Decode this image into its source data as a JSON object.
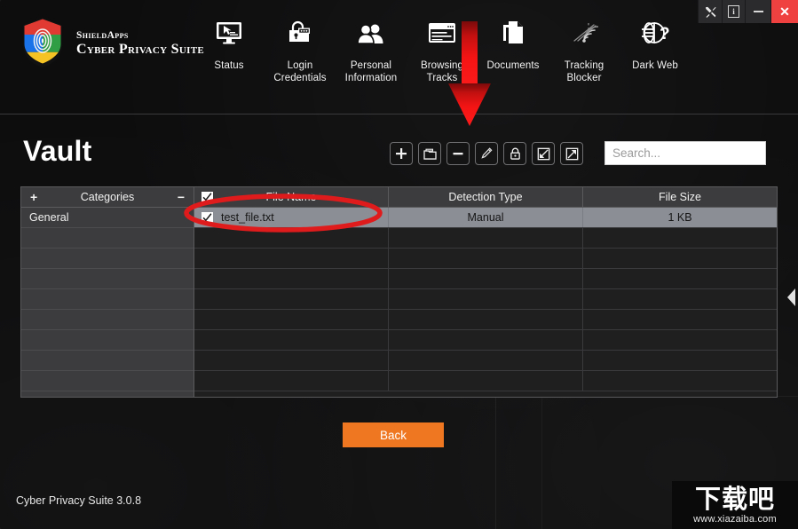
{
  "window": {
    "controls": [
      {
        "name": "tools-icon",
        "label": "Tools"
      },
      {
        "name": "info-icon",
        "label": "i"
      },
      {
        "name": "minimize-icon",
        "label": "Minimize"
      },
      {
        "name": "close-icon",
        "label": "Close"
      }
    ],
    "close_color": "#f04141"
  },
  "brand": {
    "line1": "ShieldApps",
    "line2": "Cyber Privacy Suite",
    "logo_colors": [
      "#e03a32",
      "#2f9e44",
      "#1a73e8",
      "#f6c324"
    ]
  },
  "nav": {
    "items": [
      {
        "icon": "monitor-icon",
        "label": "Status"
      },
      {
        "icon": "padlock-key-icon",
        "label": "Login\nCredentials"
      },
      {
        "icon": "people-icon",
        "label": "Personal\nInformation"
      },
      {
        "icon": "browser-window-icon",
        "label": "Browsing\nTracks"
      },
      {
        "icon": "documents-icon",
        "label": "Documents"
      },
      {
        "icon": "tracking-signal-icon",
        "label": "Tracking\nBlocker"
      },
      {
        "icon": "globe-question-icon",
        "label": "Dark Web"
      }
    ]
  },
  "page": {
    "title": "Vault",
    "back_label": "Back",
    "back_color": "#ef7722"
  },
  "toolbar": {
    "buttons": [
      {
        "name": "add-file-button",
        "icon": "plus-icon"
      },
      {
        "name": "add-folder-button",
        "icon": "folder-icon"
      },
      {
        "name": "remove-button",
        "icon": "minus-icon"
      },
      {
        "name": "edit-button",
        "icon": "pencil-icon"
      },
      {
        "name": "lock-button",
        "icon": "lock-icon"
      },
      {
        "name": "import-button",
        "icon": "arrow-into-box-icon"
      },
      {
        "name": "export-button",
        "icon": "arrow-out-of-box-icon"
      }
    ]
  },
  "search": {
    "placeholder": "Search...",
    "value": ""
  },
  "categories": {
    "header": "Categories",
    "add_label": "+",
    "remove_label": "−",
    "items": [
      "General"
    ],
    "empty_row_count": 8
  },
  "file_table": {
    "columns": [
      "File Name",
      "Detection Type",
      "File Size"
    ],
    "header_checkbox_checked": true,
    "rows": [
      {
        "checked": true,
        "file_name": "test_file.txt",
        "detection_type": "Manual",
        "file_size": "1 KB",
        "selected": true
      }
    ],
    "empty_row_count": 8,
    "selected_row_bg": "#8b8e95"
  },
  "annotations": {
    "arrow_color": "#ff0000",
    "arrow_points_to": "remove-button",
    "ellipse_color": "#e01b1b",
    "ellipse_around": "selected-file-row"
  },
  "footer": {
    "version": "Cyber Privacy Suite 3.0.8"
  },
  "watermark": {
    "text": "下载吧",
    "url": "www.xiazaiba.com"
  }
}
